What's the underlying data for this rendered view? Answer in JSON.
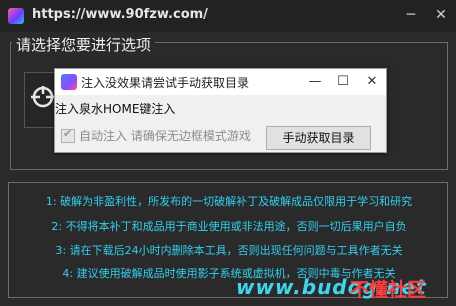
{
  "window": {
    "title": "https://www.90fzw.com/",
    "minimize_glyph": "─",
    "close_glyph": "✕"
  },
  "options": {
    "legend": "请选择您要进行选项"
  },
  "dialog": {
    "title": "注入没效果请尝试手动获取目录",
    "minimize_glyph": "—",
    "maximize_glyph": "☐",
    "close_glyph": "✕",
    "message": "注入泉水HOME键注入",
    "auto_inject_label": "自动注入 请确保无边框模式游戏",
    "auto_inject_checked": true,
    "button_label": "手动获取目录"
  },
  "notices": [
    "1: 破解为非盈利性，所发布的一切破解补丁及破解成品仅限用于学习和研究",
    "2: 不得将本补丁和成品用于商业使用或非法用途，否则一切后果用户自负",
    "3: 请在下载后24小时内删除本工具，否则出现任何问题与工具作者无关",
    "4: 建议使用破解成品时使用影子系统或虚拟机，否则中毒与作者无关"
  ],
  "watermark": {
    "site": "www.budog.net",
    "logo": "不懂社区"
  },
  "icons": {
    "app": "app-logo-icon",
    "option_card": "crosshair-icon",
    "dialog": "dialog-app-icon"
  },
  "colors": {
    "notice_text": "#2fd0f0",
    "window_bg": "#2a2a2a",
    "dialog_bg": "#f0f0f0",
    "watermark_red": "#ff3c3c"
  }
}
